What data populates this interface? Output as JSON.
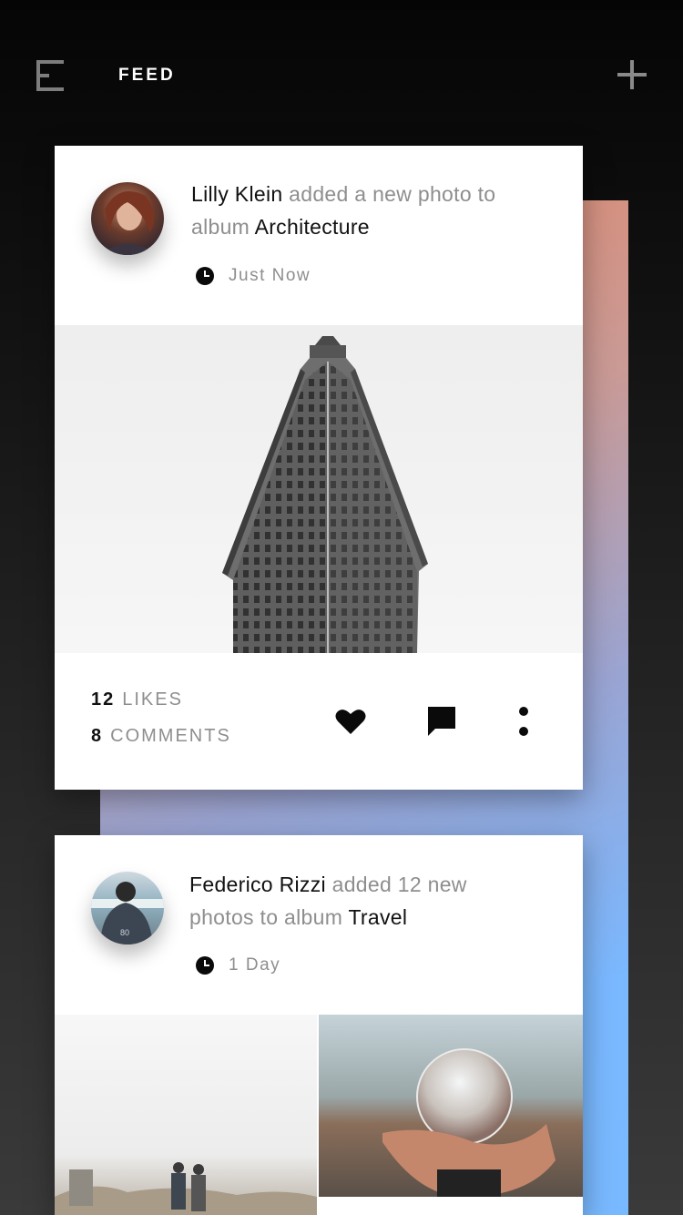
{
  "header": {
    "title": "FEED",
    "menu_icon": "menu-icon",
    "add_icon": "plus-icon"
  },
  "posts": [
    {
      "author": "Lilly Klein",
      "action_text": " added a new photo to album ",
      "album": "Architecture",
      "time": "Just Now",
      "likes_count": "12",
      "likes_label": "LIKES",
      "comments_count": "8",
      "comments_label": "COMMENTS",
      "actions": [
        "heart-icon",
        "comment-icon",
        "more-vertical-icon"
      ]
    },
    {
      "author": "Federico Rizzi",
      "action_text": " added 12 new photos to album ",
      "album": "Travel",
      "time": "1 Day"
    }
  ],
  "colors": {
    "backdrop_top": "#e0886b",
    "backdrop_bottom": "#79b9ff",
    "background": "#111111",
    "card": "#ffffff"
  }
}
